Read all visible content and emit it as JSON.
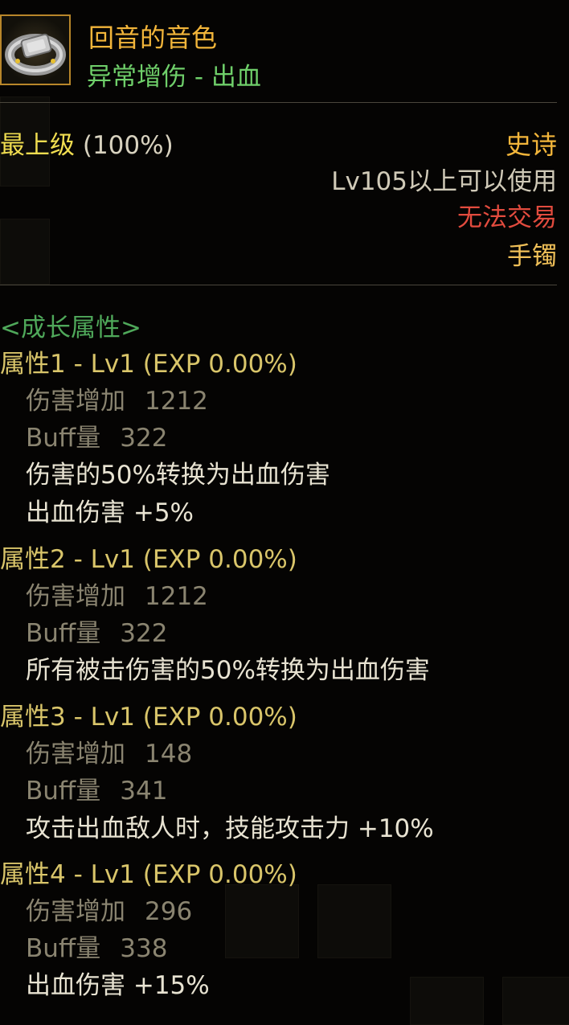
{
  "item": {
    "name": "回音的音色",
    "type": "异常增伤 - 出血",
    "icon": "bracelet-icon"
  },
  "grade": {
    "label": "最上级",
    "percent": "(100%)"
  },
  "rarity": "史诗",
  "level_requirement": "Lv105以上可以使用",
  "trade": "无法交易",
  "slot": "手镯",
  "growth_title": "<成长属性>",
  "attributes": [
    {
      "header": "属性1 - Lv1 (EXP 0.00%)",
      "damage_label": "伤害增加",
      "damage_value": "1212",
      "buff_label": "Buff量",
      "buff_value": "322",
      "effects": [
        "伤害的50%转换为出血伤害",
        "出血伤害 +5%"
      ]
    },
    {
      "header": "属性2 - Lv1 (EXP 0.00%)",
      "damage_label": "伤害增加",
      "damage_value": "1212",
      "buff_label": "Buff量",
      "buff_value": "322",
      "effects": [
        "所有被击伤害的50%转换为出血伤害"
      ]
    },
    {
      "header": "属性3 - Lv1 (EXP 0.00%)",
      "damage_label": "伤害增加",
      "damage_value": "148",
      "buff_label": "Buff量",
      "buff_value": "341",
      "effects": [
        "攻击出血敌人时，技能攻击力 +10%"
      ]
    },
    {
      "header": "属性4 - Lv1 (EXP 0.00%)",
      "damage_label": "伤害增加",
      "damage_value": "296",
      "buff_label": "Buff量",
      "buff_value": "338",
      "effects": [
        "出血伤害 +15%"
      ]
    }
  ],
  "colors": {
    "name": "#f2b53a",
    "type": "#6fcf6a",
    "grade": "#f0dd50",
    "trade": "#e24b3e",
    "growth": "#4fa85a",
    "attr_header": "#d9c56a"
  }
}
